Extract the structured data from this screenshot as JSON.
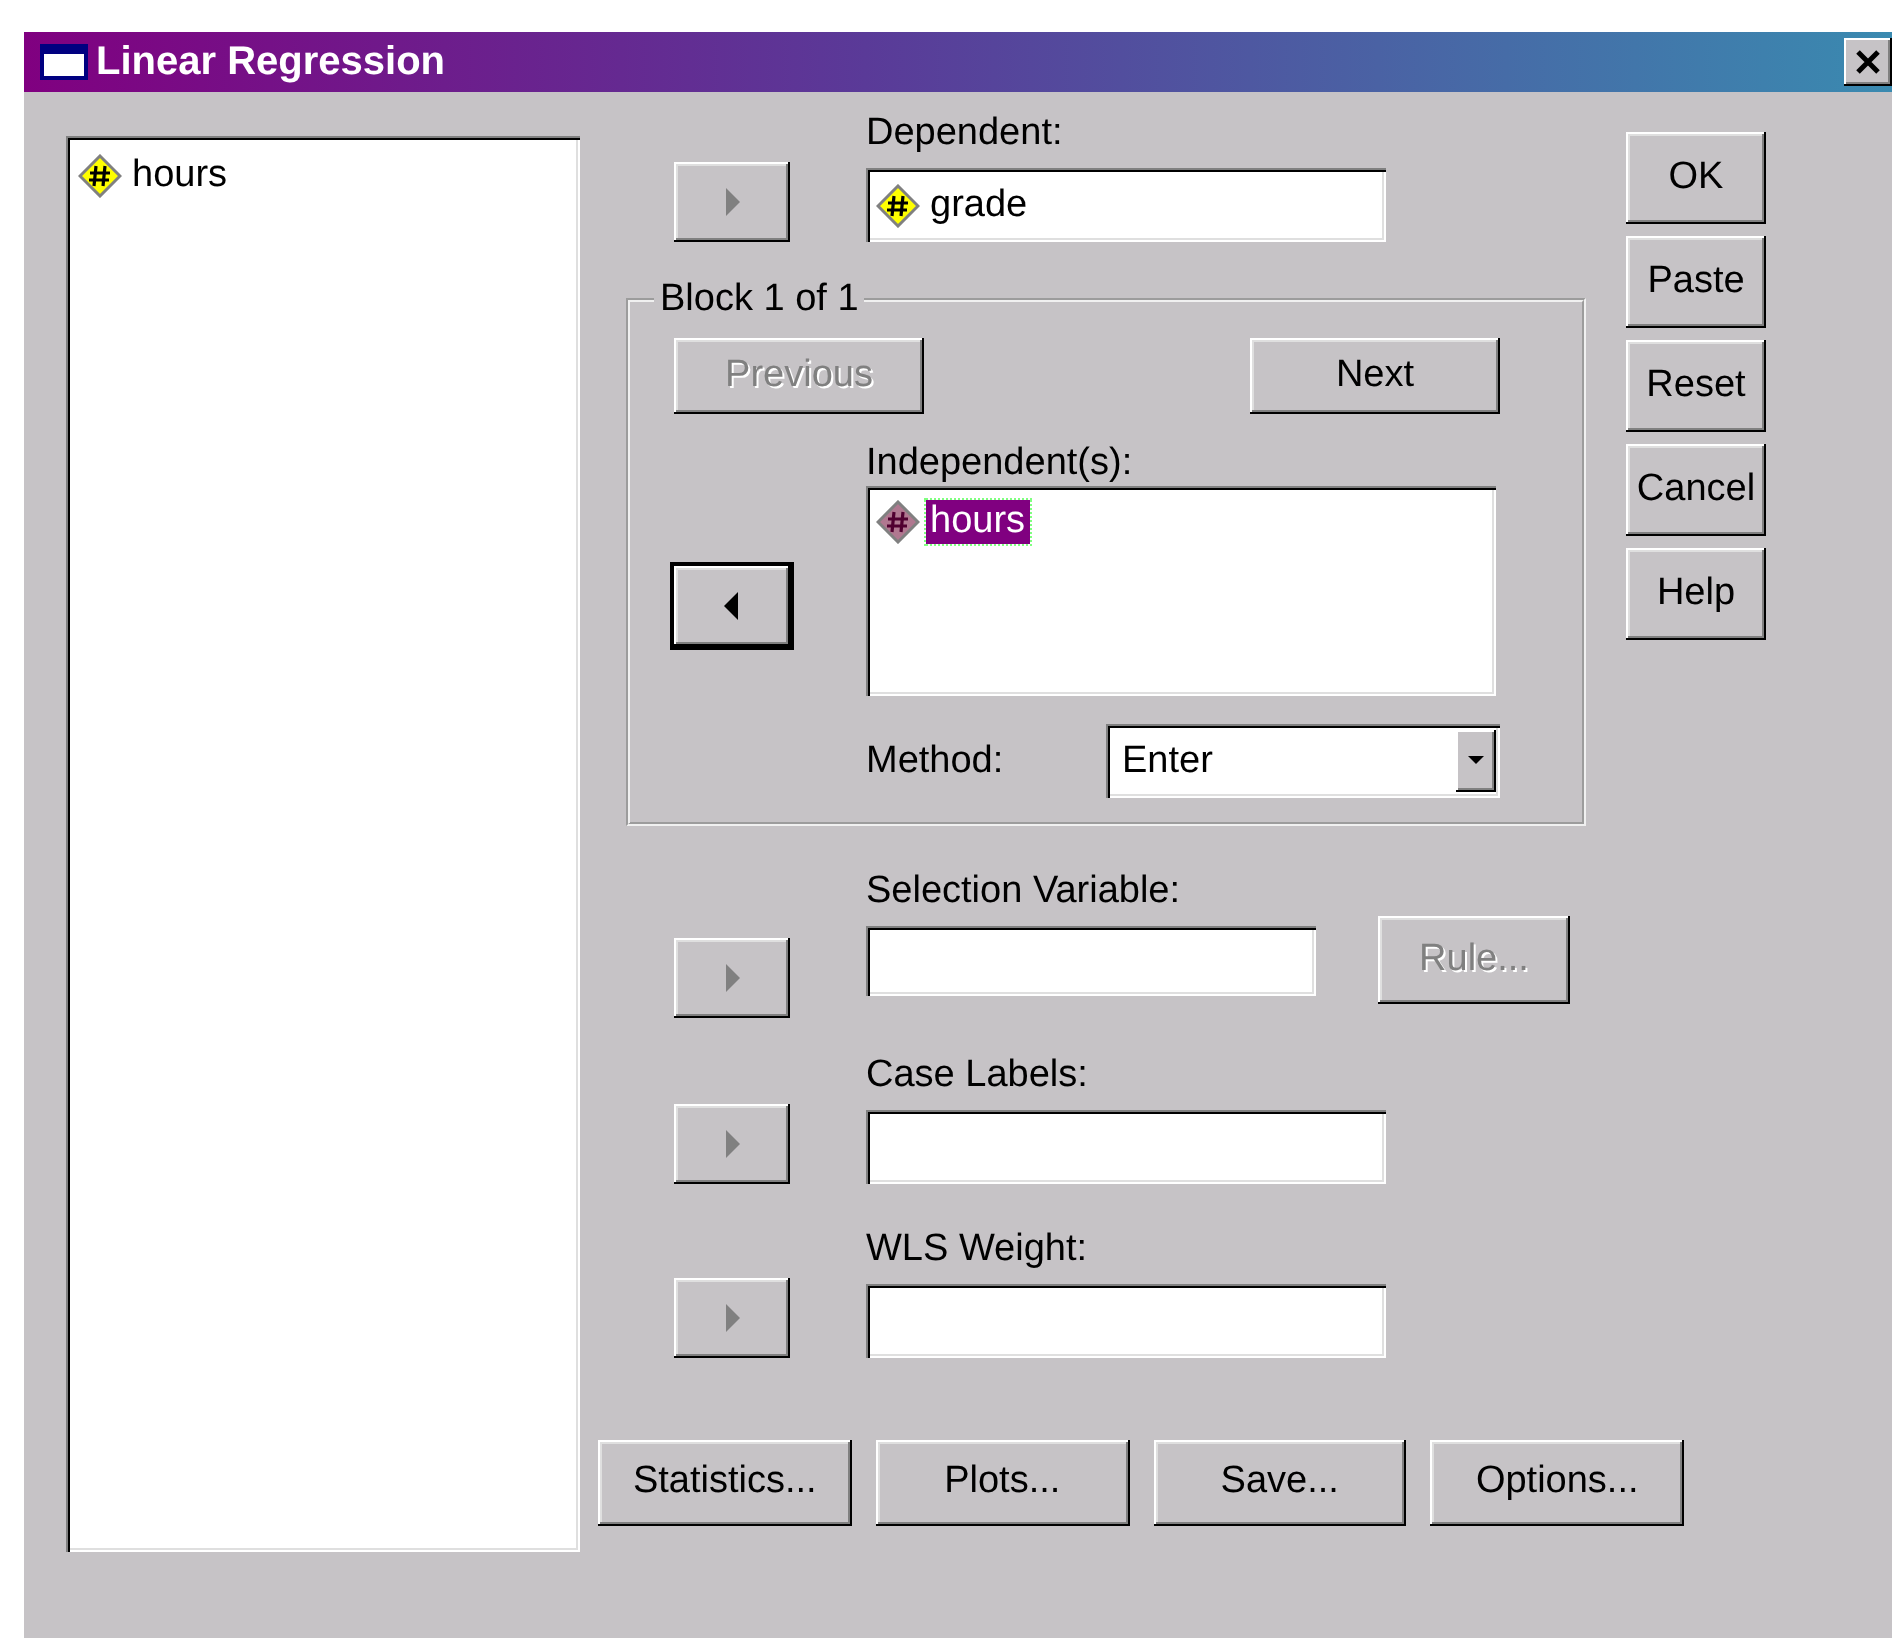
{
  "window": {
    "title": "Linear Regression"
  },
  "source_list": {
    "items": [
      {
        "label": "hours",
        "selected": false
      }
    ]
  },
  "dependent": {
    "label": "Dependent:",
    "arrow": {
      "points_left": false,
      "focused": false
    },
    "items": [
      {
        "label": "grade",
        "selected": false
      }
    ]
  },
  "block": {
    "title": "Block 1 of 1",
    "previous": {
      "label": "Previous",
      "disabled": true
    },
    "next": {
      "label": "Next",
      "disabled": false
    },
    "arrow": {
      "points_left": true,
      "focused": true
    },
    "independents": {
      "label": "Independent(s):",
      "items": [
        {
          "label": "hours",
          "selected": true
        }
      ]
    },
    "method": {
      "label": "Method:",
      "value": "Enter"
    }
  },
  "selection_variable": {
    "label": "Selection Variable:",
    "arrow": {
      "points_left": false,
      "focused": false
    },
    "rule": {
      "label": "Rule...",
      "disabled": true
    }
  },
  "case_labels": {
    "label": "Case Labels:",
    "arrow": {
      "points_left": false,
      "focused": false
    }
  },
  "wls_weight": {
    "label": "WLS Weight:",
    "arrow": {
      "points_left": false,
      "focused": false
    }
  },
  "side_buttons": [
    {
      "label": "OK"
    },
    {
      "label": "Paste"
    },
    {
      "label": "Reset"
    },
    {
      "label": "Cancel"
    },
    {
      "label": "Help"
    }
  ],
  "bottom_buttons": [
    {
      "label": "Statistics..."
    },
    {
      "label": "Plots..."
    },
    {
      "label": "Save..."
    },
    {
      "label": "Options..."
    }
  ]
}
